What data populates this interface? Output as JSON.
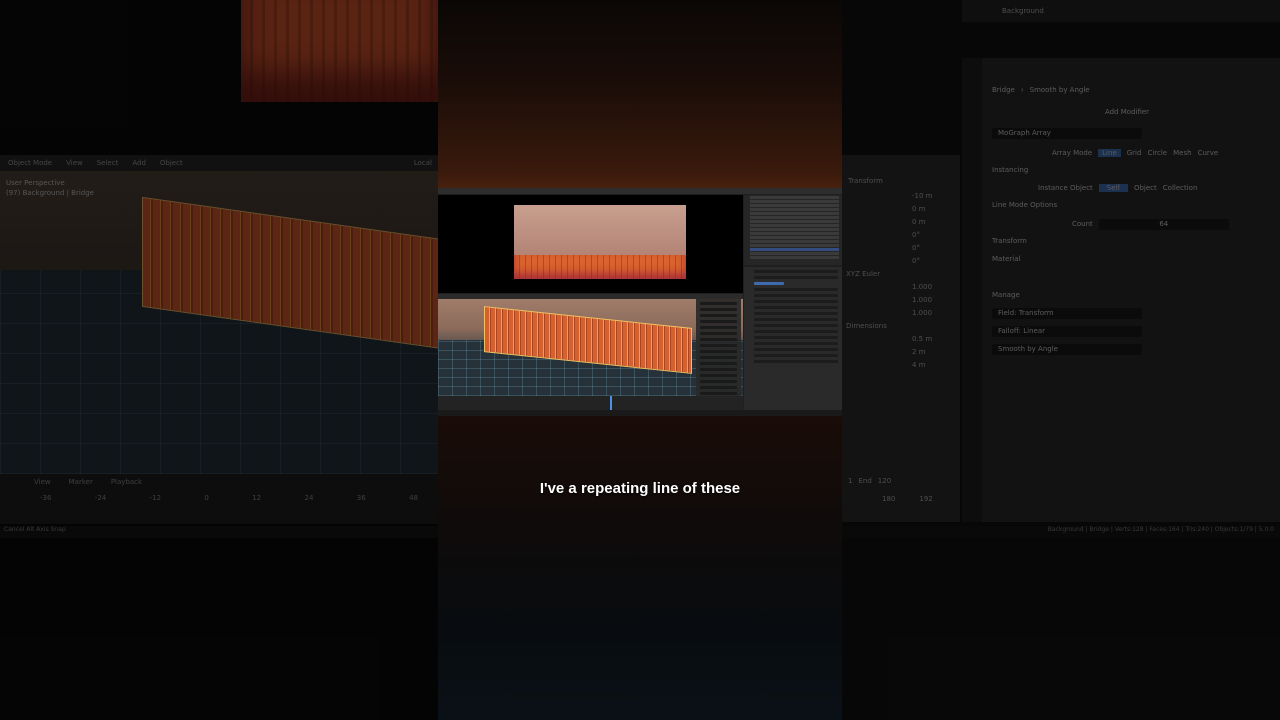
{
  "caption": "I've a repeating line of these",
  "left_pane": {
    "header_items": [
      "Object Mode",
      "View",
      "Select",
      "Add",
      "Object",
      "Local"
    ],
    "viewport_label": "User Perspective",
    "viewport_sublabel": "(97) Background | Bridge",
    "timeline_items": [
      "View",
      "Marker",
      "Playback"
    ],
    "frame_numbers": [
      "-36",
      "-24",
      "-12",
      "0",
      "12",
      "24",
      "36",
      "48"
    ],
    "status_text": "Cancel   Alt Axis Snap"
  },
  "right_pane": {
    "outliner_item": "Background",
    "breadcrumb": [
      "Bridge",
      "Smooth by Angle"
    ],
    "add_modifier_label": "Add Modifier",
    "modifier_name": "MoGraph Array",
    "array_mode_label": "Array Mode",
    "array_mode_options": [
      "Line",
      "Grid",
      "Circle",
      "Mesh",
      "Curve"
    ],
    "instancing_label": "Instancing",
    "instance_object_label": "Instance Object",
    "instance_options": [
      "Self",
      "Object",
      "Collection"
    ],
    "line_mode_options_label": "Line Mode Options",
    "count_label": "Count",
    "count_value": "64",
    "transform_label": "Transform",
    "material_label": "Material",
    "manage_label": "Manage",
    "stack": [
      "Field: Transform",
      "Falloff: Linear",
      "Smooth by Angle"
    ],
    "n_panel": {
      "transform_label": "Transform",
      "values": [
        "-10 m",
        "0 m",
        "0 m",
        "0°",
        "0°",
        "0°",
        "1.000",
        "1.000",
        "1.000",
        "0.5 m",
        "2 m",
        "4 m"
      ],
      "rotation_mode": "XYZ Euler",
      "dimensions_label": "Dimensions"
    },
    "timeline_end_label": "End",
    "timeline_end_value": "120",
    "timeline_start_value": "1",
    "frame_numbers": [
      "180",
      "192"
    ],
    "status_text": "Background | Bridge | Verts:128 | Faces:164 | Tris:240 | Objects:1/79 | 5.0.0"
  },
  "colors": {
    "selection_blue": "#4f8fe8",
    "fence_orange": "#d5612f",
    "panel_dark": "#282828"
  }
}
